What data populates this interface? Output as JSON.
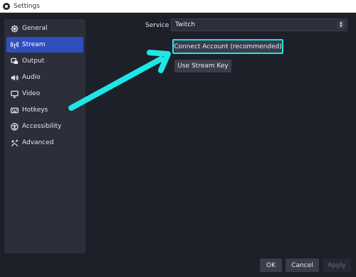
{
  "window": {
    "title": "Settings"
  },
  "sidebar": {
    "items": [
      {
        "label": "General",
        "icon": "gear-icon",
        "active": false
      },
      {
        "label": "Stream",
        "icon": "antenna-icon",
        "active": true
      },
      {
        "label": "Output",
        "icon": "output-icon",
        "active": false
      },
      {
        "label": "Audio",
        "icon": "speaker-icon",
        "active": false
      },
      {
        "label": "Video",
        "icon": "monitor-icon",
        "active": false
      },
      {
        "label": "Hotkeys",
        "icon": "keyboard-icon",
        "active": false
      },
      {
        "label": "Accessibility",
        "icon": "accessibility-icon",
        "active": false
      },
      {
        "label": "Advanced",
        "icon": "tools-icon",
        "active": false
      }
    ]
  },
  "stream": {
    "service_label": "Service",
    "service_value": "Twitch",
    "connect_button": "Connect Account (recommended)",
    "stream_key_button": "Use Stream Key"
  },
  "footer": {
    "ok": "OK",
    "cancel": "Cancel",
    "apply": "Apply"
  },
  "colors": {
    "background": "#1d1f29",
    "panel": "#2c2e3a",
    "active_item": "#2f4fbf",
    "highlight": "#1ee6e6"
  }
}
